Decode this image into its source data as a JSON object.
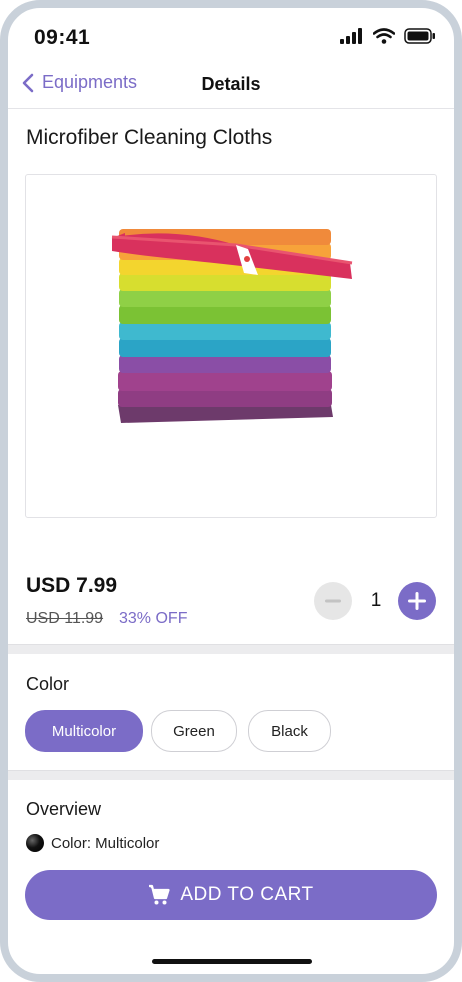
{
  "status_bar": {
    "time": "09:41"
  },
  "nav": {
    "back_label": "Equipments",
    "title": "Details"
  },
  "product": {
    "title": "Microfiber Cleaning Cloths",
    "image_alt": "stack of multicolor microfiber cloths",
    "price": "USD 7.99",
    "old_price": "USD 11.99",
    "discount": "33% OFF",
    "quantity": "1"
  },
  "color_section": {
    "label": "Color",
    "options": [
      "Multicolor",
      "Green",
      "Black"
    ],
    "selected": "Multicolor"
  },
  "overview": {
    "label": "Overview",
    "color_attr": "Color: Multicolor"
  },
  "cart_button": {
    "label": "ADD TO CART"
  },
  "colors": {
    "accent": "#7b6cc7",
    "divider": "#ececee"
  },
  "icons": {
    "back": "chevron-left-icon",
    "signal": "signal-icon",
    "wifi": "wifi-icon",
    "battery": "battery-icon",
    "minus": "minus-icon",
    "plus": "plus-icon",
    "cart": "cart-icon"
  }
}
